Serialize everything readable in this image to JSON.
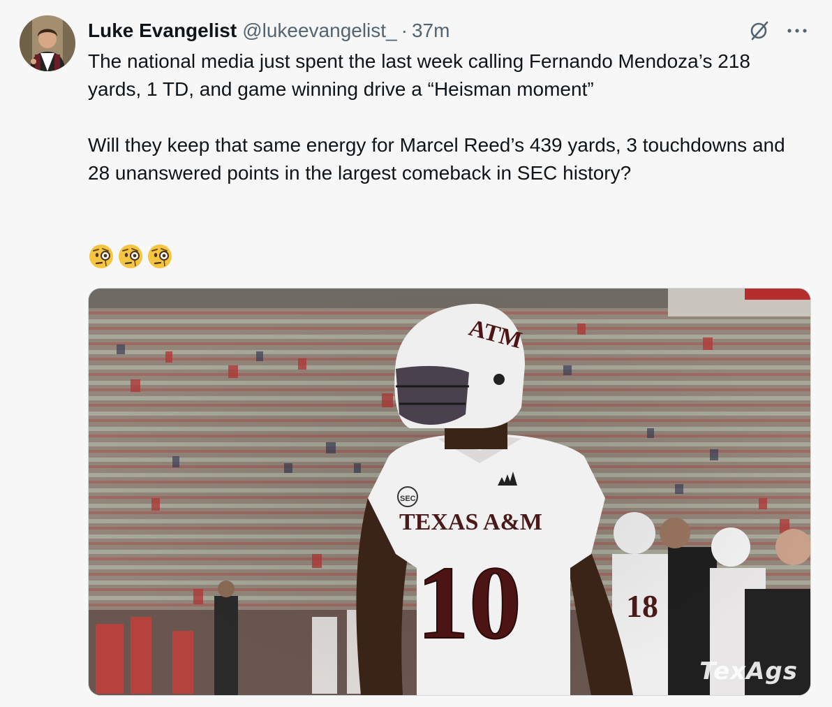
{
  "author": {
    "display_name": "Luke Evangelist",
    "handle": "@lukeevangelist_",
    "separator": "·",
    "time": "37m"
  },
  "tweet": {
    "paragraph_1": "The national media just spent the last week calling Fernando Mendoza’s 218 yards, 1 TD, and game winning drive a “Heisman moment”",
    "paragraph_2": "Will they keep that same energy for Marcel Reed’s 439 yards, 3 touchdowns and 28 unanswered points in the largest comeback in SEC history?",
    "emojis": [
      "face-with-monocle",
      "face-with-monocle",
      "face-with-monocle"
    ]
  },
  "media": {
    "jersey_text": "TEXAS A&M",
    "jersey_number": "10",
    "helmet_logo": "ATM",
    "conference_patch": "SEC",
    "teammate_number": "18",
    "watermark": "TexAgs"
  },
  "icons": {
    "grok": "grok-icon",
    "more": "more-dots-icon"
  },
  "colors": {
    "text": "#0f1419",
    "secondary": "#536471",
    "background": "#f7f7f7",
    "maroon": "#500000"
  }
}
